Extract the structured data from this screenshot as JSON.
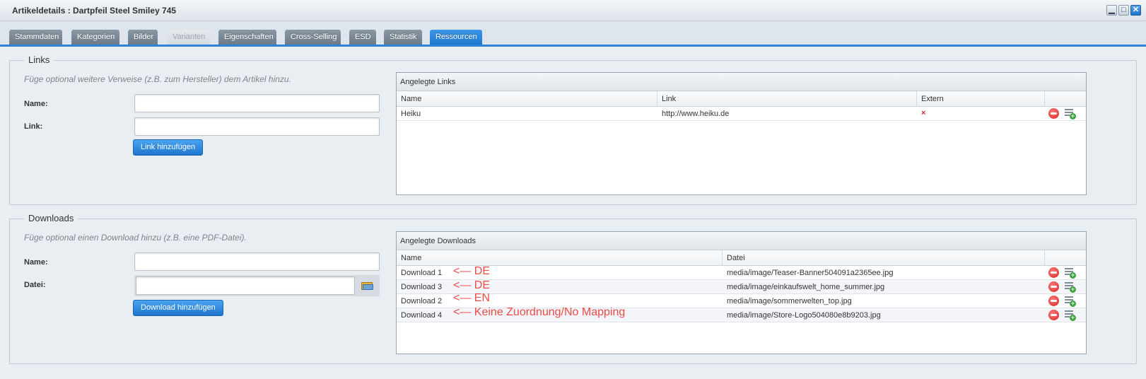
{
  "window": {
    "title": "Artikeldetails : Dartpfeil Steel Smiley 745",
    "buttons": [
      "minimize",
      "maximize",
      "close"
    ]
  },
  "tabs": [
    {
      "label": "Stammdaten",
      "state": "normal"
    },
    {
      "label": "Kategorien",
      "state": "normal"
    },
    {
      "label": "Bilder",
      "state": "normal"
    },
    {
      "label": "Varianten",
      "state": "disabled"
    },
    {
      "label": "Eigenschaften",
      "state": "normal"
    },
    {
      "label": "Cross-Selling",
      "state": "normal"
    },
    {
      "label": "ESD",
      "state": "normal"
    },
    {
      "label": "Statistik",
      "state": "normal"
    },
    {
      "label": "Ressourcen",
      "state": "active"
    }
  ],
  "links": {
    "legend": "Links",
    "hint": "Füge optional weitere Verweise (z.B. zum Hersteller) dem Artikel hinzu.",
    "name_label": "Name:",
    "name_value": "",
    "link_label": "Link:",
    "link_value": "",
    "add_button": "Link hinzufügen",
    "grid": {
      "title": "Angelegte Links",
      "columns": [
        "Name",
        "Link",
        "Extern"
      ],
      "rows": [
        {
          "name": "Heiku",
          "link": "http://www.heiku.de",
          "extern": "×"
        }
      ]
    }
  },
  "downloads": {
    "legend": "Downloads",
    "hint": "Füge optional einen Download hinzu (z.B. eine PDF-Datei).",
    "name_label": "Name:",
    "name_value": "",
    "file_label": "Datei:",
    "file_value": "",
    "add_button": "Download hinzufügen",
    "grid": {
      "title": "Angelegte Downloads",
      "columns": [
        "Name",
        "Datei"
      ],
      "rows": [
        {
          "name": "Download 1",
          "note": "<— DE",
          "file": "media/image/Teaser-Banner504091a2365ee.jpg"
        },
        {
          "name": "Download 3",
          "note": "<— DE",
          "file": "media/image/einkaufswelt_home_summer.jpg"
        },
        {
          "name": "Download 2",
          "note": "<— EN",
          "file": "media/image/sommerwelten_top.jpg"
        },
        {
          "name": "Download 4",
          "note": "<— Keine Zuordnung/No Mapping",
          "file": "media/image/Store-Logo504080e8b9203.jpg"
        }
      ]
    }
  },
  "colors": {
    "accent": "#2a83d6",
    "annotation": "#f04a48",
    "delete": "#d8231f",
    "add": "#3aa33a"
  },
  "icons": {
    "delete": "minus-circle-icon",
    "add_row": "add-row-icon",
    "file_browse": "folder-icon",
    "extern_false": "x-icon"
  }
}
